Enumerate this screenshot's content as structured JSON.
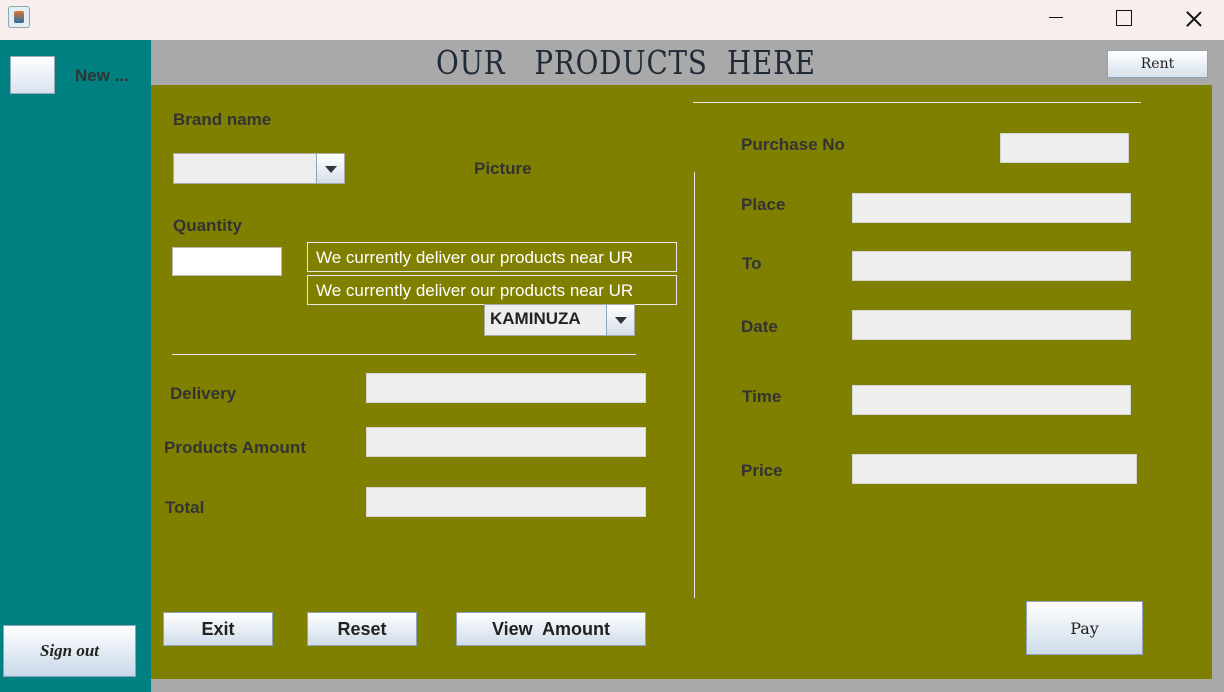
{
  "window": {
    "icon": "java-coffee-icon",
    "controls": [
      "minimize-icon",
      "maximize-icon",
      "close-icon"
    ]
  },
  "sidebar": {
    "new_label": "New ...",
    "signout_label": "Sign out"
  },
  "header": {
    "title": "OUR   PRODUCTS  HERE",
    "rent_label": "Rent"
  },
  "form": {
    "brand_label": "Brand name",
    "brand_value": "",
    "picture_label": "Picture",
    "quantity_label": "Quantity",
    "quantity_value": "",
    "notice_1": "We currently deliver our products near UR",
    "notice_2": "We currently deliver our products near UR",
    "campus_value": "KAMINUZA",
    "delivery_label": "Delivery",
    "products_amount_label": "Products Amount",
    "total_label": "Total"
  },
  "purchase": {
    "purchase_no_label": "Purchase No",
    "place_label": "Place",
    "to_label": "To",
    "date_label": "Date",
    "time_label": "Time",
    "price_label": "Price"
  },
  "actions": {
    "exit_label": "Exit",
    "reset_label": "Reset",
    "view_amount_label": "View  Amount",
    "pay_label": "Pay"
  },
  "colors": {
    "sidebar": "#008080",
    "main_panel": "#808000",
    "header_bar": "#a9a9a9"
  }
}
